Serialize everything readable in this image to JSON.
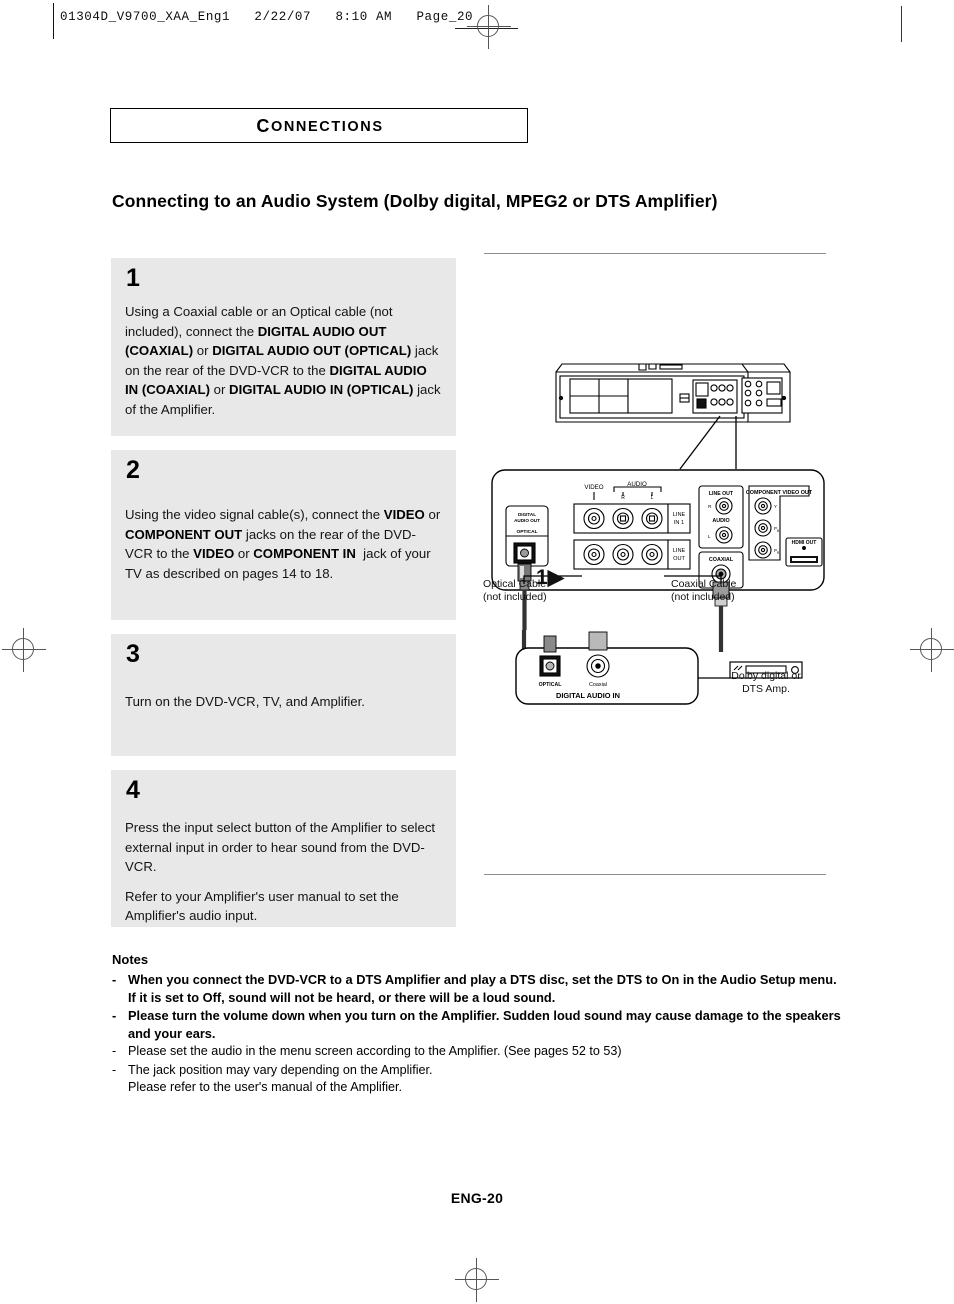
{
  "scan_header": {
    "text": "01304D_V9700_XAA_Eng1   2/22/07   8:10 AM   Page_20"
  },
  "section": {
    "label_first": "C",
    "label_rest": "ONNECTIONS"
  },
  "headline": "Connecting to an Audio System (Dolby digital, MPEG2 or DTS Amplifier)",
  "steps": [
    {
      "number": "1",
      "html": "Using a Coaxial cable or an Optical cable (not included), connect the <b>DIGITAL AUDIO OUT (COAXIAL)</b> or <b>DIGITAL AUDIO OUT (OPTICAL)</b> jack on the rear of the DVD-VCR to the <b>DIGITAL AUDIO IN (COAXIAL)</b> or <b>DIGITAL AUDIO IN (OPTICAL)</b> jack of the Amplifier."
    },
    {
      "number": "2",
      "html": "Using the video signal cable(s), connect the <b>VIDEO</b> or <b>COMPONENT OUT</b> jacks on the rear of the DVD-VCR to the <b>VIDEO</b> or <b>COMPONENT IN</b>&nbsp; jack of your TV as described on pages 14 to 18."
    },
    {
      "number": "3",
      "html": "Turn on the DVD-VCR, TV, and Amplifier."
    },
    {
      "number": "4",
      "html": "<p>Press the input select button of the Amplifier to select external input in order to hear sound from the DVD-VCR.</p><p>Refer to your Amplifier's user manual to set the Amplifier's audio input.</p>"
    }
  ],
  "notes": {
    "heading": "Notes",
    "items": [
      {
        "dash": "-",
        "bold": true,
        "text": "When you connect the DVD-VCR to a DTS Amplifier and play a DTS disc, set the DTS to On in the Audio Setup menu. If it is set to Off, sound will not be heard, or there will be a loud sound."
      },
      {
        "dash": "-",
        "bold": true,
        "text": "Please turn the volume down when you turn on the Amplifier. Sudden loud sound may cause damage to the speakers and your ears."
      },
      {
        "dash": "-",
        "bold": false,
        "text": "Please set the audio in the menu screen according to the Amplifier. (See pages 52 to 53)"
      },
      {
        "dash": "-",
        "bold": false,
        "text": "The  jack position may vary depending on the Amplifier.\nPlease refer to the user's manual of the Amplifier."
      }
    ]
  },
  "folio": "ENG-20",
  "diagram": {
    "optical_cable_label": "Optical Cable\n(not included)",
    "coaxial_cable_label": "Coaxial Cable\n(not included)",
    "amp_label": "Dolby digital or\nDTS Amp.",
    "step_marker": "1",
    "panel_labels": {
      "digital_audio_out": "DIGITAL\nAUDIO OUT",
      "optical": "OPTICAL",
      "video": "VIDEO",
      "audio": "AUDIO",
      "audio_r": "R",
      "audio_l": "L",
      "line_in_1": "LINE\nIN 1",
      "line_out": "LINE\nOUT",
      "line_out_block": "LINE OUT",
      "audio_block": "AUDIO",
      "coaxial": "COAXIAL",
      "component_video_out": "COMPONENT VIDEO OUT",
      "component_y": "Y",
      "component_pb": "PB",
      "component_pr": "PR",
      "hdmi_out": "HDMI OUT"
    },
    "amp_panel": {
      "optical": "OPTICAL",
      "coaxial": "Coaxial",
      "digital_audio_in": "DIGITAL AUDIO IN"
    }
  },
  "colors": {
    "step_bg": "#e8e8e8",
    "rule": "#8c8c8c",
    "text": "#000000"
  }
}
